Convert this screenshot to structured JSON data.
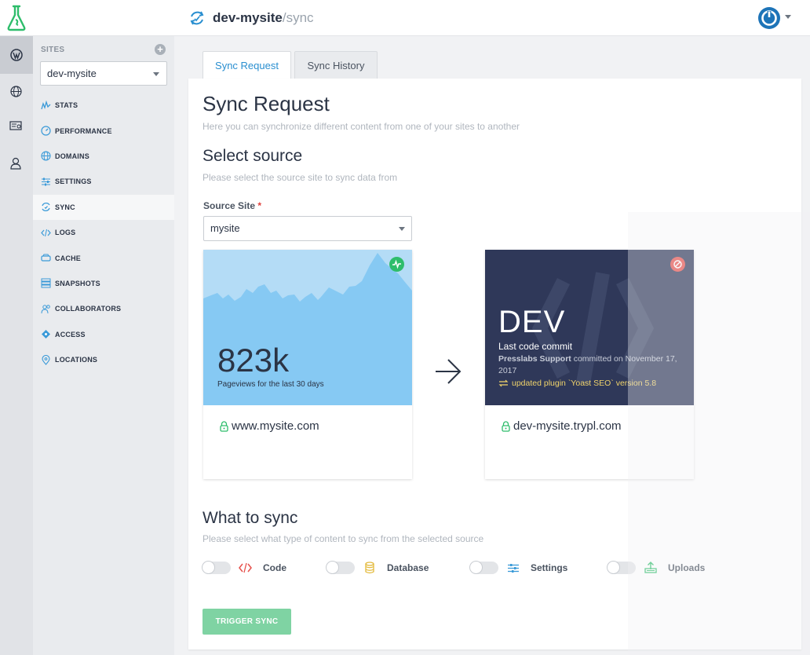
{
  "topbar": {
    "site": "dev-mysite",
    "slash": "/",
    "page": "sync",
    "icons": {
      "logo": "flask-logo-icon",
      "breadcrumb": "sync-icon",
      "user": "power-icon"
    }
  },
  "rail": {
    "items": [
      {
        "name": "wordpress-icon",
        "active": true
      },
      {
        "name": "globe-icon",
        "active": false
      },
      {
        "name": "billing-icon",
        "active": false
      },
      {
        "name": "user-icon",
        "active": false
      }
    ]
  },
  "sidebar": {
    "sites_label": "SITES",
    "add_label": "+",
    "site_select": "dev-mysite",
    "items": [
      {
        "label": "STATS",
        "icon": "stats-icon"
      },
      {
        "label": "PERFORMANCE",
        "icon": "performance-icon"
      },
      {
        "label": "DOMAINS",
        "icon": "globe-icon"
      },
      {
        "label": "SETTINGS",
        "icon": "sliders-icon"
      },
      {
        "label": "SYNC",
        "icon": "sync-icon",
        "active": true
      },
      {
        "label": "LOGS",
        "icon": "code-icon"
      },
      {
        "label": "CACHE",
        "icon": "cache-icon"
      },
      {
        "label": "SNAPSHOTS",
        "icon": "snapshots-icon"
      },
      {
        "label": "COLLABORATORS",
        "icon": "collaborators-icon"
      },
      {
        "label": "ACCESS",
        "icon": "access-icon"
      },
      {
        "label": "LOCATIONS",
        "icon": "location-pin-icon"
      }
    ]
  },
  "tabs": {
    "sync_request": "Sync Request",
    "sync_history": "Sync History"
  },
  "main": {
    "title": "Sync Request",
    "subtitle": "Here you can synchronize different content from one of your sites to another",
    "source_title": "Select source",
    "source_subtitle": "Please select the source site to sync data from",
    "source_label": "Source Site",
    "required_mark": "*",
    "source_value": "mysite",
    "source_card": {
      "pageviews": "823k",
      "pageviews_label": "Pageviews for the last 30 days",
      "url": "www.mysite.com"
    },
    "dest_card": {
      "env": "DEV",
      "commit_title": "Last code commit",
      "commit_author": "Presslabs Support",
      "commit_text": "committed on November 17, 2017",
      "commit_message": "updated plugin `Yoast SEO` version 5.8",
      "url": "dev-mysite.trypl.com"
    },
    "what_title": "What to sync",
    "what_subtitle": "Please select what type of content to sync from the selected source",
    "options": [
      {
        "label": "Code",
        "icon": "code-icon",
        "enabled": false
      },
      {
        "label": "Database",
        "icon": "database-icon",
        "enabled": false
      },
      {
        "label": "Settings",
        "icon": "sliders-icon",
        "enabled": false
      },
      {
        "label": "Uploads",
        "icon": "upload-icon",
        "enabled": false
      }
    ],
    "trigger": "TRIGGER SYNC"
  },
  "colors": {
    "accent": "#2a8fd0",
    "green": "#2ebd6b",
    "red": "#e6514c",
    "dev_bg": "#2f3859",
    "chart_bg": "#b4dcf6"
  }
}
